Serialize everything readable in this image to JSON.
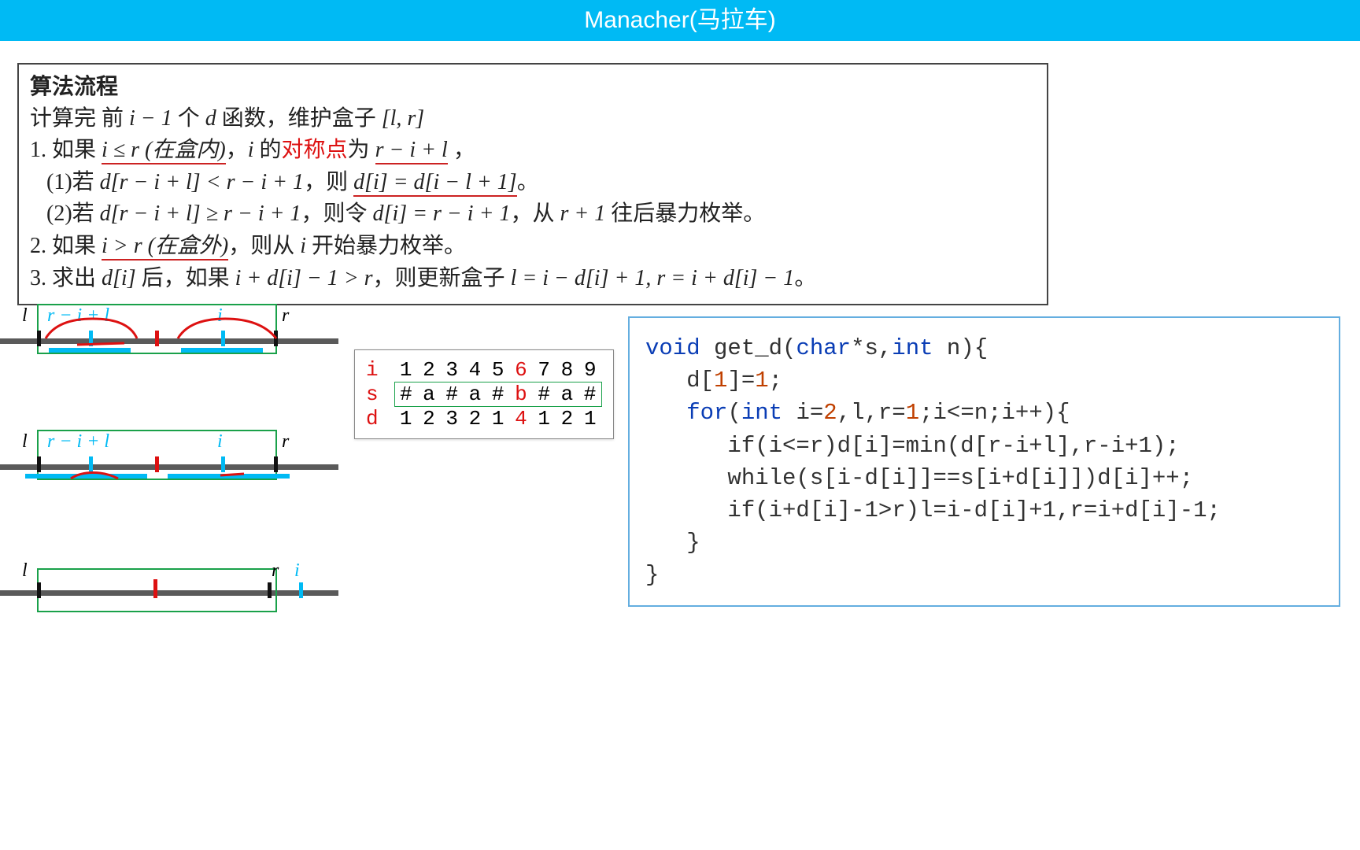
{
  "header": {
    "title": "Manacher(马拉车)"
  },
  "flow": {
    "title": "算法流程",
    "intro_a": "计算完 前 ",
    "intro_b": "i − 1",
    "intro_c": " 个 ",
    "intro_d": "d",
    "intro_e": " 函数，维护盒子 ",
    "intro_f": "[l, r]",
    "step1_a": "1. 如果 ",
    "step1_b": "i ≤ r (在盒内)",
    "step1_c": "，",
    "step1_d": "i",
    "step1_e": " 的",
    "step1_f": "对称点",
    "step1_g": "为 ",
    "step1_h": "r − i + l",
    "step1_i": " ，",
    "sub1_a": "   (1)若 ",
    "sub1_b": "d[r − i + l] < r − i + 1",
    "sub1_c": "，则 ",
    "sub1_d": "d[i] = d[i − l + 1]",
    "sub1_e": "。",
    "sub2_a": "   (2)若 ",
    "sub2_b": "d[r − i + l] ≥ r − i + 1",
    "sub2_c": "，则令 ",
    "sub2_d": "d[i] = r − i + 1",
    "sub2_e": "，从 ",
    "sub2_f": "r + 1",
    "sub2_g": " 往后暴力枚举。",
    "step2_a": "2. 如果 ",
    "step2_b": "i > r (在盒外)",
    "step2_c": "，则从 ",
    "step2_d": "i",
    "step2_e": " 开始暴力枚举。",
    "step3_a": "3. 求出 ",
    "step3_b": "d[i]",
    "step3_c": " 后，如果 ",
    "step3_d": "i + d[i] − 1 > r",
    "step3_e": "，则更新盒子 ",
    "step3_f": "l = i − d[i] + 1, r = i + d[i] − 1",
    "step3_g": "。"
  },
  "diagram": {
    "l": "l",
    "r": "r",
    "mirror": "r − i + l",
    "i": "i"
  },
  "table": {
    "head": [
      "i",
      "1",
      "2",
      "3",
      "4",
      "5",
      "6",
      "7",
      "8",
      "9"
    ],
    "head_hl": [
      false,
      false,
      false,
      false,
      false,
      false,
      true,
      false,
      false,
      false
    ],
    "s": [
      "s",
      "#",
      "a",
      "#",
      "a",
      "#",
      "b",
      "#",
      "a",
      "#"
    ],
    "s_hl": [
      false,
      false,
      false,
      false,
      false,
      false,
      true,
      false,
      false,
      false
    ],
    "d": [
      "d",
      "1",
      "2",
      "3",
      "2",
      "1",
      "4",
      "1",
      "2",
      "1"
    ],
    "d_hl": [
      false,
      false,
      false,
      false,
      false,
      false,
      true,
      false,
      false,
      false
    ]
  },
  "code": {
    "l1a": "void",
    "l1b": " get_d(",
    "l1c": "char",
    "l1d": "*s,",
    "l1e": "int",
    "l1f": " n){",
    "l2a": "   d[",
    "l2b": "1",
    "l2c": "]=",
    "l2d": "1",
    "l2e": ";",
    "l3a": "   ",
    "l3b": "for",
    "l3c": "(",
    "l3d": "int",
    "l3e": " i=",
    "l3f": "2",
    "l3g": ",l,r=",
    "l3h": "1",
    "l3i": ";i<=n;i++){",
    "l4": "      if(i<=r)d[i]=min(d[r-i+l],r-i+1);",
    "l5": "      while(s[i-d[i]]==s[i+d[i]])d[i]++;",
    "l6": "      if(i+d[i]-1>r)l=i-d[i]+1,r=i+d[i]-1;",
    "l7": "   }",
    "l8": "}"
  }
}
